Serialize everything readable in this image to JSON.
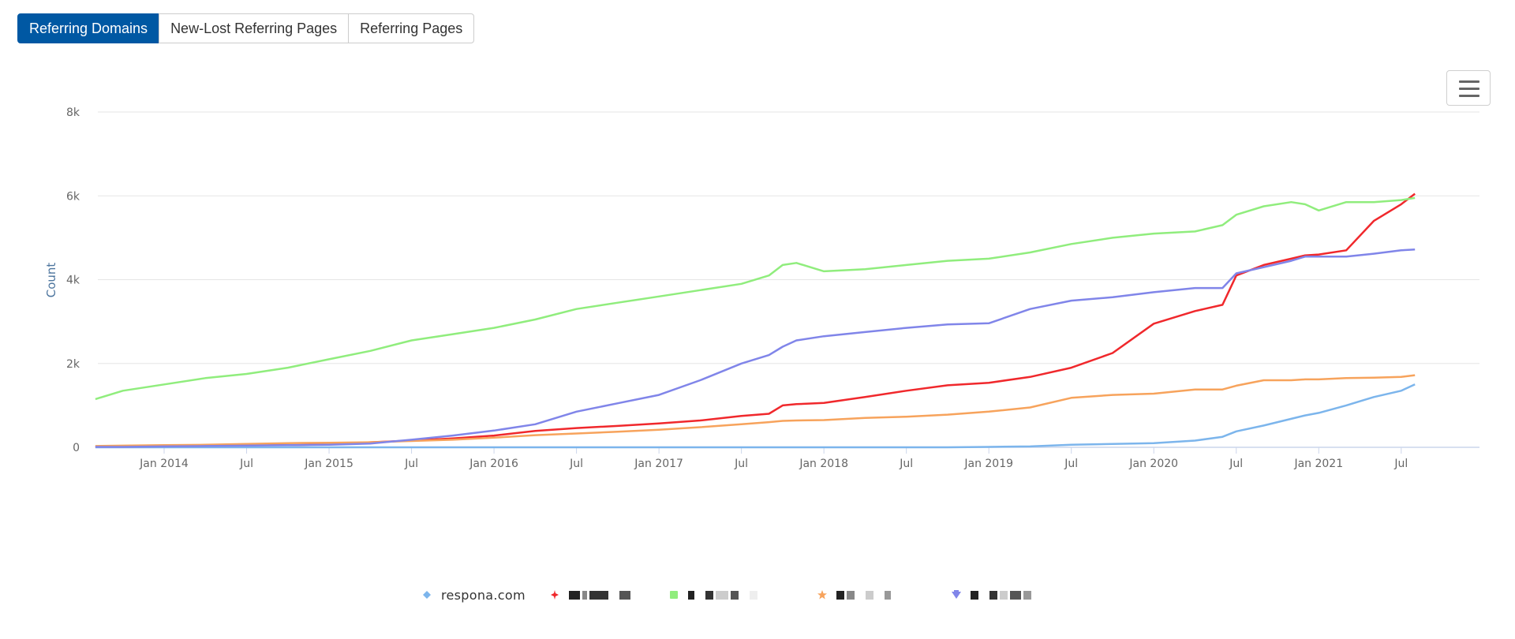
{
  "tabs": [
    {
      "label": "Referring Domains",
      "active": true
    },
    {
      "label": "New-Lost Referring Pages",
      "active": false
    },
    {
      "label": "Referring Pages",
      "active": false
    }
  ],
  "menu": {
    "icon": "hamburger-menu-icon"
  },
  "chart_data": {
    "type": "line",
    "title": "",
    "xlabel": "",
    "ylabel": "Count",
    "ylim": [
      0,
      8000
    ],
    "yticks": [
      0,
      2000,
      4000,
      6000,
      8000
    ],
    "ytick_labels": [
      "0",
      "2k",
      "4k",
      "6k",
      "8k"
    ],
    "xlim": [
      "2013-05",
      "2022-02"
    ],
    "xticks": [
      "2014-01",
      "2014-07",
      "2015-01",
      "2015-07",
      "2016-01",
      "2016-07",
      "2017-01",
      "2017-07",
      "2018-01",
      "2018-07",
      "2019-01",
      "2019-07",
      "2020-01",
      "2020-07",
      "2021-01",
      "2021-07"
    ],
    "xtick_labels": [
      "Jan 2014",
      "Jul",
      "Jan 2015",
      "Jul",
      "Jan 2016",
      "Jul",
      "Jan 2017",
      "Jul",
      "Jan 2018",
      "Jul",
      "Jan 2019",
      "Jul",
      "Jan 2020",
      "Jul",
      "Jan 2021",
      "Jul"
    ],
    "grid": true,
    "legend": "bottom-center",
    "x": [
      "2013-08",
      "2013-10",
      "2014-01",
      "2014-04",
      "2014-07",
      "2014-10",
      "2015-01",
      "2015-04",
      "2015-07",
      "2015-10",
      "2016-01",
      "2016-04",
      "2016-07",
      "2016-10",
      "2017-01",
      "2017-04",
      "2017-07",
      "2017-09",
      "2017-10",
      "2017-11",
      "2018-01",
      "2018-04",
      "2018-07",
      "2018-10",
      "2019-01",
      "2019-04",
      "2019-07",
      "2019-10",
      "2020-01",
      "2020-04",
      "2020-06",
      "2020-07",
      "2020-09",
      "2020-11",
      "2020-12",
      "2021-01",
      "2021-03",
      "2021-05",
      "2021-07",
      "2021-08"
    ],
    "series": [
      {
        "name": "respona.com",
        "color": "#7cb5ec",
        "marker": "diamond",
        "values": [
          0,
          0,
          0,
          0,
          0,
          0,
          0,
          0,
          0,
          0,
          0,
          0,
          0,
          0,
          0,
          0,
          0,
          0,
          0,
          0,
          0,
          0,
          0,
          0,
          10,
          20,
          60,
          80,
          100,
          160,
          250,
          380,
          520,
          680,
          760,
          820,
          1000,
          1200,
          1350,
          1500
        ]
      },
      {
        "name": "",
        "redacted": true,
        "color": "#f0282c",
        "marker": "cross",
        "values": [
          20,
          30,
          40,
          40,
          60,
          50,
          70,
          120,
          160,
          210,
          280,
          390,
          460,
          510,
          570,
          640,
          750,
          800,
          1000,
          1030,
          1060,
          1200,
          1350,
          1480,
          1540,
          1680,
          1900,
          2250,
          2950,
          3250,
          3400,
          4100,
          4350,
          4500,
          4580,
          4600,
          4700,
          5400,
          5800,
          6050
        ]
      },
      {
        "name": "",
        "redacted": true,
        "color": "#90ed7d",
        "marker": "square",
        "values": [
          1150,
          1350,
          1500,
          1650,
          1750,
          1900,
          2100,
          2300,
          2550,
          2700,
          2850,
          3050,
          3300,
          3450,
          3600,
          3750,
          3900,
          4100,
          4350,
          4400,
          4200,
          4250,
          4350,
          4450,
          4500,
          4650,
          4850,
          5000,
          5100,
          5150,
          5300,
          5550,
          5750,
          5850,
          5800,
          5650,
          5850,
          5850,
          5900,
          5950
        ]
      },
      {
        "name": "",
        "redacted": true,
        "color": "#f7a35c",
        "marker": "star",
        "values": [
          30,
          40,
          50,
          60,
          80,
          100,
          110,
          120,
          150,
          180,
          230,
          290,
          330,
          370,
          420,
          480,
          550,
          600,
          630,
          640,
          650,
          700,
          730,
          780,
          850,
          950,
          1180,
          1250,
          1280,
          1380,
          1380,
          1470,
          1600,
          1600,
          1620,
          1620,
          1650,
          1660,
          1680,
          1720
        ]
      },
      {
        "name": "",
        "redacted": true,
        "color": "#8085e9",
        "marker": "triangle-down",
        "values": [
          10,
          10,
          20,
          30,
          40,
          50,
          60,
          90,
          180,
          280,
          400,
          550,
          850,
          1050,
          1250,
          1600,
          2000,
          2200,
          2400,
          2550,
          2650,
          2750,
          2850,
          2930,
          2960,
          3300,
          3500,
          3580,
          3700,
          3800,
          3800,
          4150,
          4300,
          4450,
          4550,
          4550,
          4550,
          4620,
          4700,
          4720
        ]
      }
    ]
  },
  "legend": {
    "items": [
      {
        "label": "respona.com",
        "redacted": false
      },
      {
        "label": "",
        "redacted": true
      },
      {
        "label": "",
        "redacted": true
      },
      {
        "label": "",
        "redacted": true
      },
      {
        "label": "",
        "redacted": true
      }
    ]
  }
}
